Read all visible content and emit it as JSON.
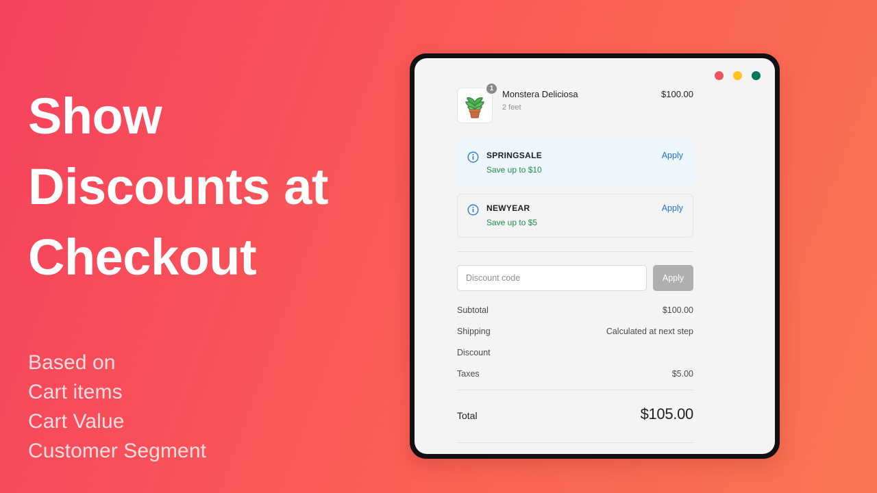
{
  "hero": {
    "headline_lines": [
      "Show",
      "Discounts at",
      "Checkout"
    ],
    "subtitle_lines": [
      "Based on",
      "Cart items",
      "Cart Value",
      "Customer Segment"
    ]
  },
  "colors": {
    "gradient_start": "#F6425C",
    "gradient_end": "#FB7450",
    "headline": "#FFFFFF",
    "subtitle": "#FCDDE0",
    "accent_link": "#1F73D0",
    "savings_green": "#1F8A4C",
    "highlight_bg": "#EDF5FD",
    "traffic_red": "#F4515F",
    "traffic_yellow": "#FFC31C",
    "traffic_green": "#00795B"
  },
  "window": {
    "traffic_lights": [
      "close-button",
      "minimize-button",
      "maximize-button"
    ]
  },
  "checkout": {
    "line_item": {
      "title": "Monstera Deliciosa",
      "variant": "2 feet",
      "price": "$100.00",
      "quantity": "1",
      "thumbnail_icon": "potted-plant-image"
    },
    "offers": [
      {
        "code": "SPRINGSALE",
        "savings": "Save up to $10",
        "apply_label": "Apply",
        "highlighted": true,
        "icon": "info-icon"
      },
      {
        "code": "NEWYEAR",
        "savings": "Save up to $5",
        "apply_label": "Apply",
        "highlighted": false,
        "icon": "info-icon"
      }
    ],
    "code_entry": {
      "placeholder": "Discount code",
      "value": "",
      "apply_label": "Apply"
    },
    "summary": {
      "rows": [
        {
          "label": "Subtotal",
          "value": "$100.00"
        },
        {
          "label": "Shipping",
          "value": "Calculated at next step"
        },
        {
          "label": "Discount",
          "value": ""
        },
        {
          "label": "Taxes",
          "value": "$5.00"
        }
      ],
      "total_label": "Total",
      "total_value": "$105.00"
    }
  }
}
